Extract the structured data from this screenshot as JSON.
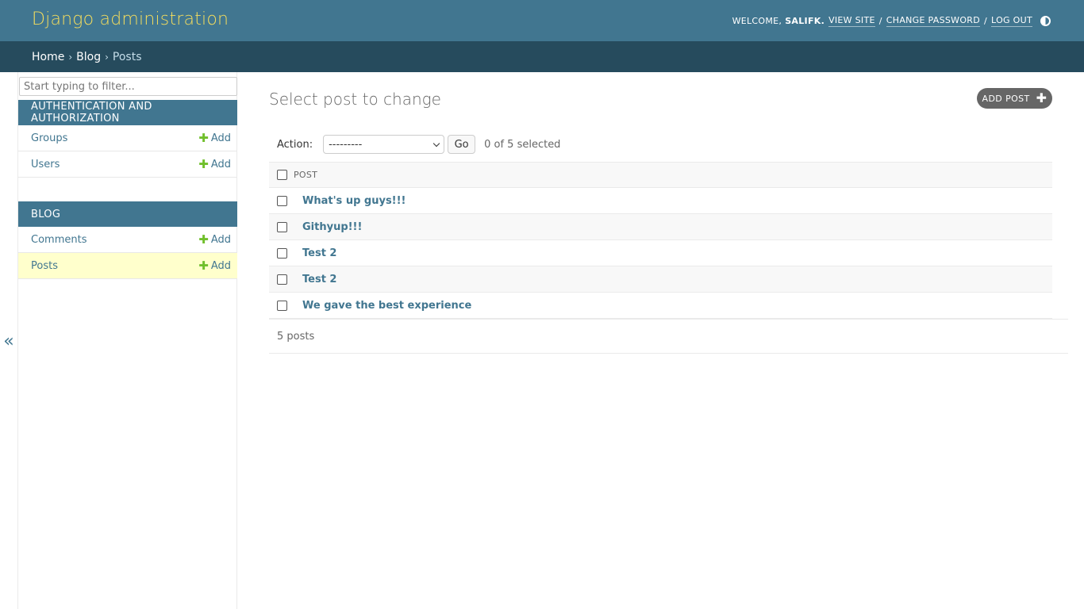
{
  "header": {
    "site_name": "Django administration",
    "welcome": "WELCOME,",
    "username": "SALIFK.",
    "view_site": "VIEW SITE",
    "change_password": "CHANGE PASSWORD",
    "log_out": "LOG OUT",
    "separator": "/"
  },
  "breadcrumbs": {
    "home": "Home",
    "app": "Blog",
    "current": "Posts",
    "separator": "›"
  },
  "sidebar": {
    "filter_placeholder": "Start typing to filter...",
    "collapse_label": "«",
    "modules": [
      {
        "caption": "AUTHENTICATION AND AUTHORIZATION",
        "models": [
          {
            "name": "Groups",
            "add": "Add"
          },
          {
            "name": "Users",
            "add": "Add"
          }
        ]
      },
      {
        "caption": "BLOG",
        "models": [
          {
            "name": "Comments",
            "add": "Add"
          },
          {
            "name": "Posts",
            "add": "Add",
            "current": true
          }
        ]
      }
    ]
  },
  "main": {
    "title": "Select post to change",
    "add_button": "ADD POST",
    "action_label": "Action:",
    "action_selected": "---------",
    "go_label": "Go",
    "selection_count": "0 of 5 selected",
    "column_header": "POST",
    "rows": [
      "What's up guys!!!",
      "Githyup!!!",
      "Test 2",
      "Test 2",
      "We gave the best experience"
    ],
    "paginator": "5 posts"
  },
  "colors": {
    "header_bg": "#417690",
    "breadcrumb_bg": "#264b5d",
    "brand_text": "#f5dd5d",
    "link": "#417690",
    "add_icon": "#70bf2b",
    "current_row": "#ffffcc"
  }
}
